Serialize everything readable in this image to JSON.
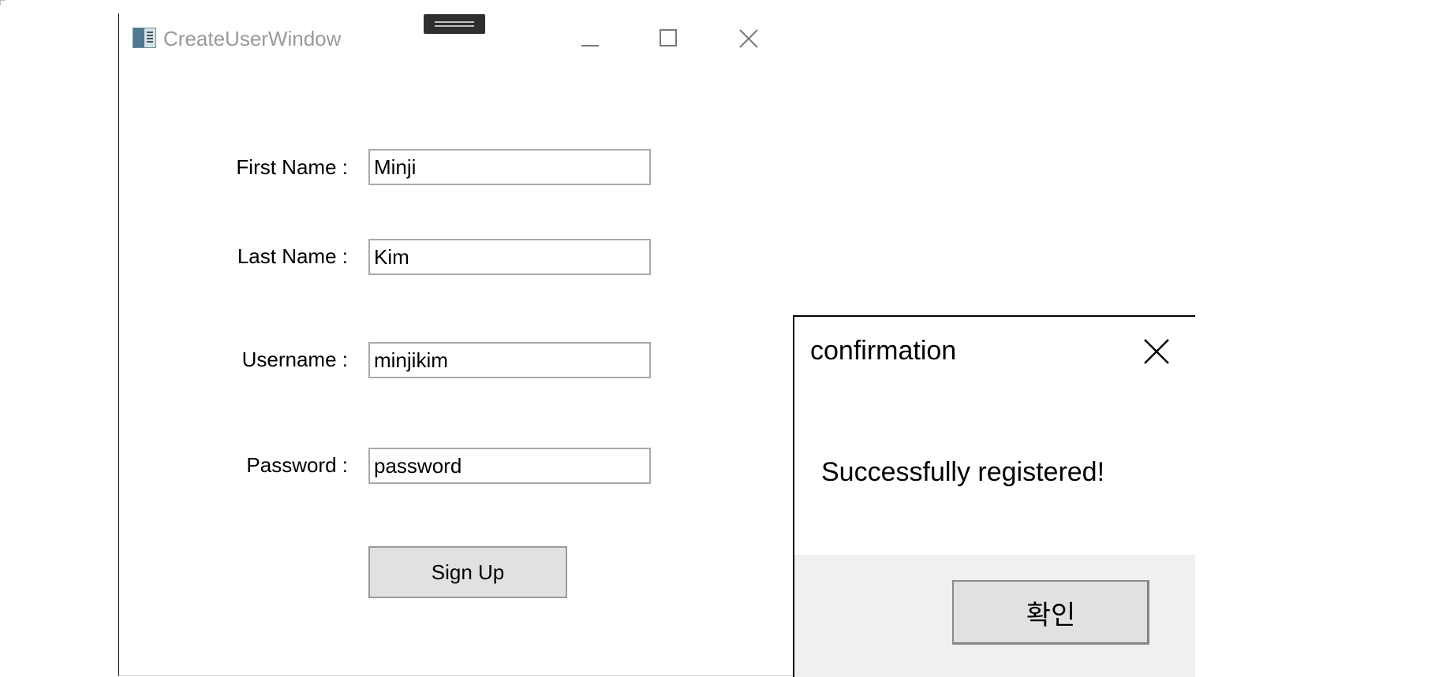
{
  "window": {
    "title": "CreateUserWindow",
    "icons": {
      "app": "app-window-icon",
      "minimize": "minimize-icon",
      "maximize": "maximize-icon",
      "close": "close-icon"
    }
  },
  "form": {
    "first_name_label": "First Name :",
    "first_name_value": "Minji",
    "last_name_label": "Last Name :",
    "last_name_value": "Kim",
    "username_label": "Username :",
    "username_value": "minjikim",
    "password_label": "Password :",
    "password_value": "password",
    "signup_label": "Sign Up"
  },
  "dialog": {
    "title": "confirmation",
    "message": "Successfully registered!",
    "ok_label": "확인",
    "close_icon": "close-icon"
  }
}
